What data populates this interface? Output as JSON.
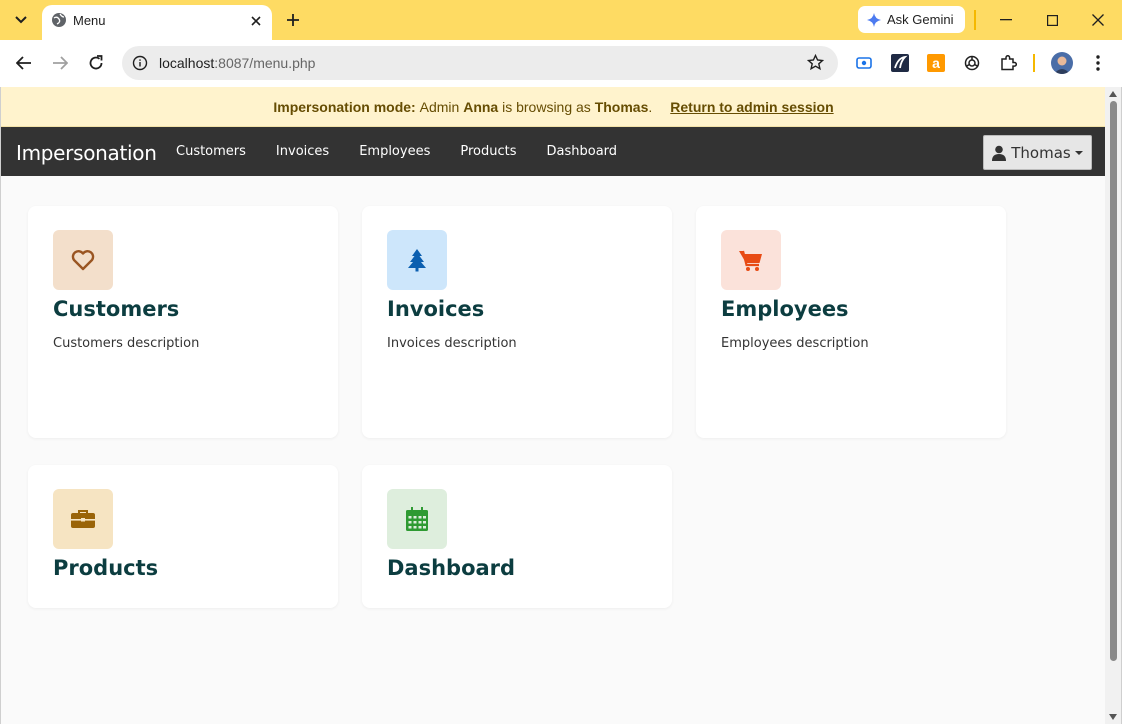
{
  "browser": {
    "tab_title": "Menu",
    "url_host": "localhost",
    "url_rest": ":8087/menu.php",
    "gemini_label": "Ask Gemini"
  },
  "banner": {
    "mode_label": "Impersonation mode:",
    "text_admin": "Admin",
    "admin_name": "Anna",
    "text_browsing": "is browsing as",
    "user_name": "Thomas",
    "return_link": "Return to admin session"
  },
  "navbar": {
    "brand": "Impersonation",
    "links": [
      "Customers",
      "Invoices",
      "Employees",
      "Products",
      "Dashboard"
    ],
    "user_button": "Thomas"
  },
  "cards": [
    {
      "title": "Customers",
      "description": "Customers description",
      "icon": "heart-icon",
      "icon_bg": "#f3dfcb",
      "icon_color": "#9a5522"
    },
    {
      "title": "Invoices",
      "description": "Invoices description",
      "icon": "tree-icon",
      "icon_bg": "#cde6fb",
      "icon_color": "#0b5fb0"
    },
    {
      "title": "Employees",
      "description": "Employees description",
      "icon": "cart-icon",
      "icon_bg": "#fbe2da",
      "icon_color": "#e84b14"
    },
    {
      "title": "Products",
      "description": "",
      "icon": "briefcase-icon",
      "icon_bg": "#f6e4c2",
      "icon_color": "#9a6408"
    },
    {
      "title": "Dashboard",
      "description": "",
      "icon": "calendar-icon",
      "icon_bg": "#deeedd",
      "icon_color": "#2e9a32"
    }
  ]
}
